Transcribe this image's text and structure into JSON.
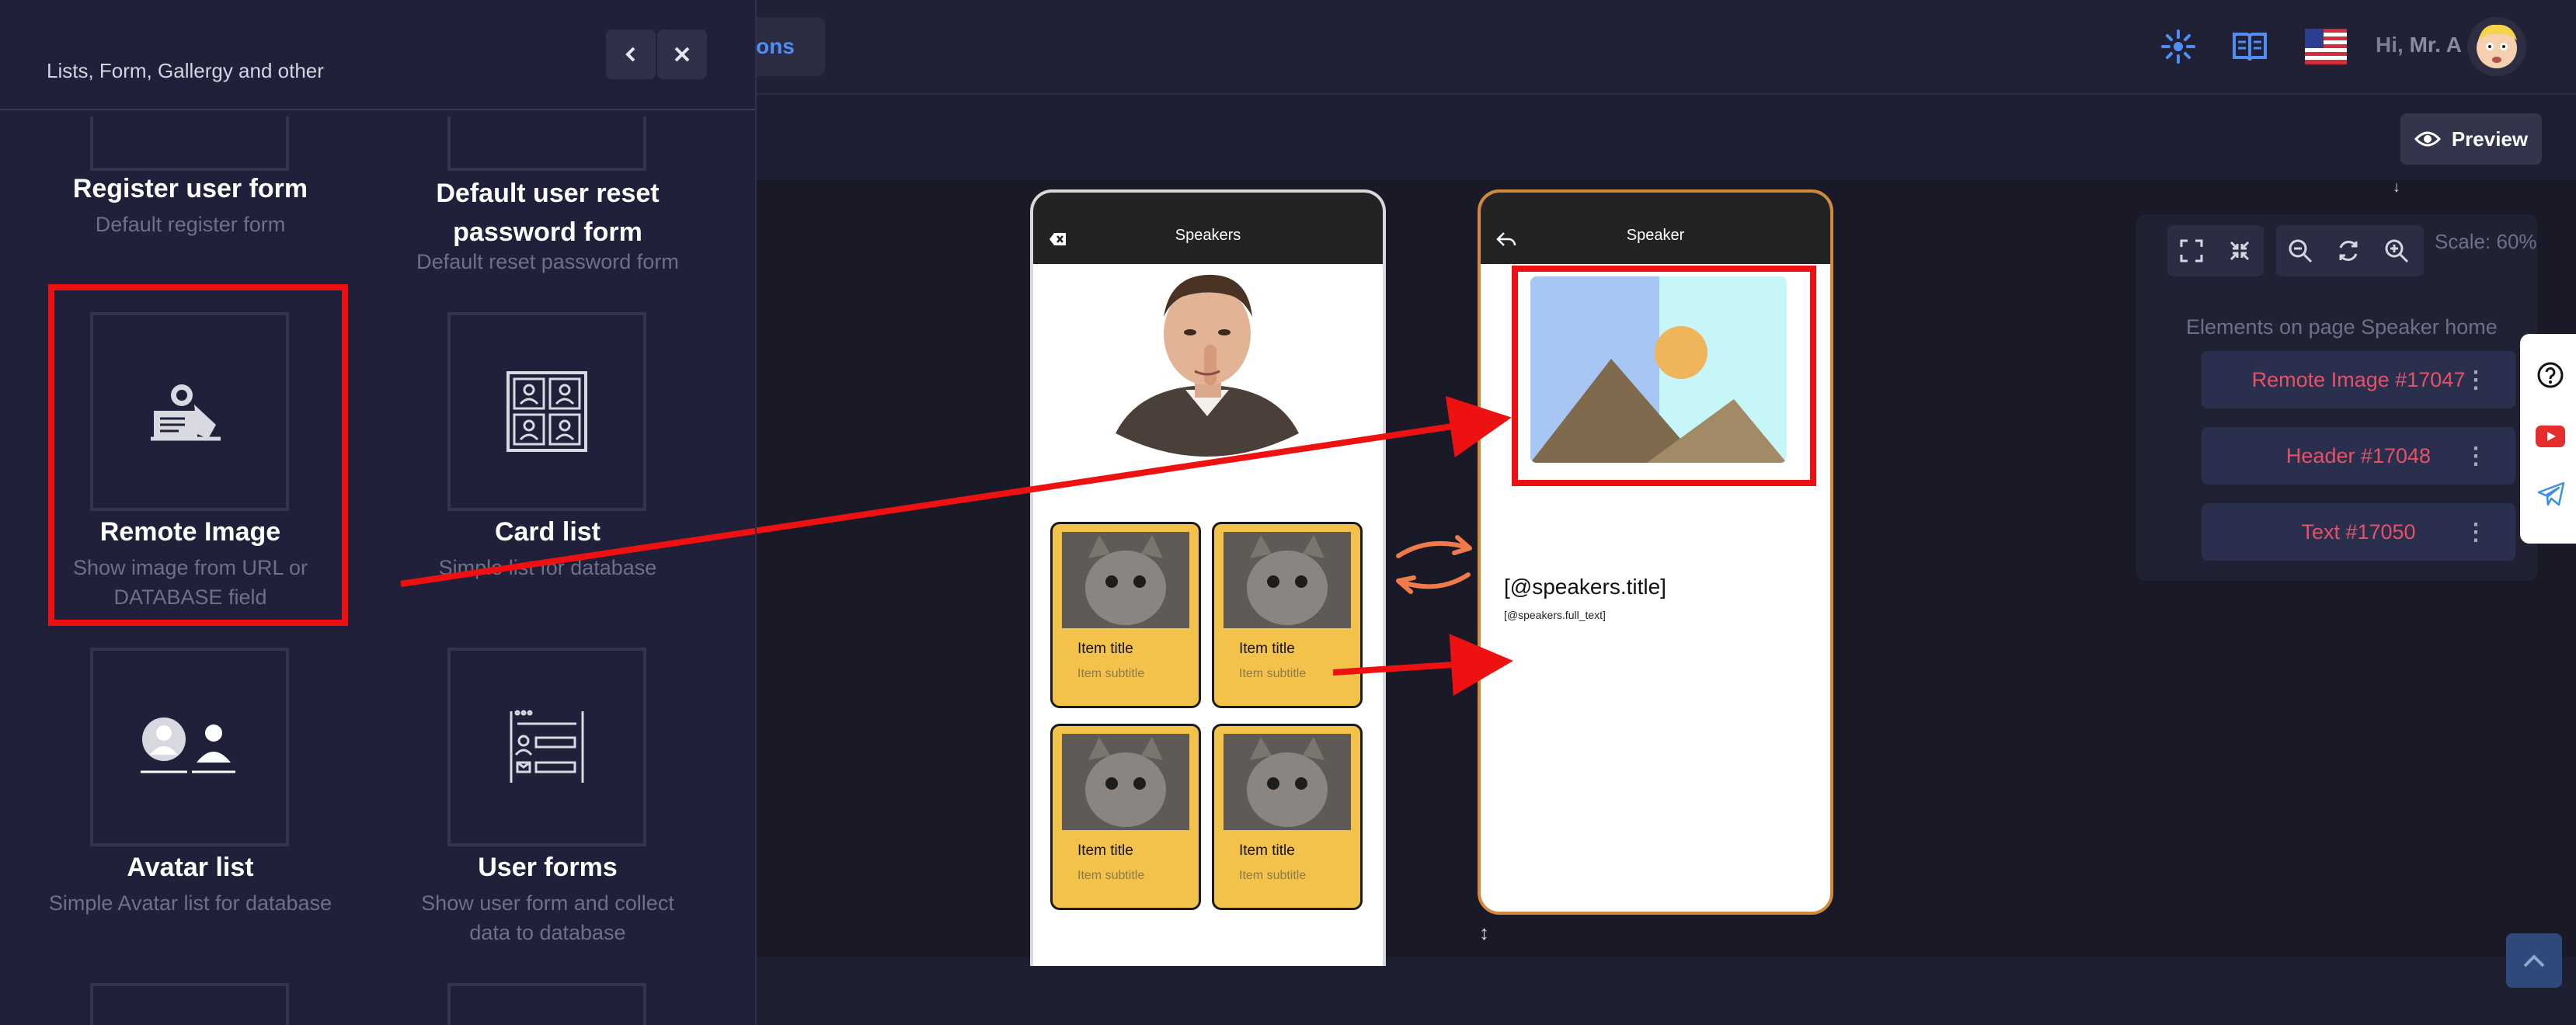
{
  "topbar": {
    "tab_label": "tions",
    "greeting_hi": "Hi,",
    "greeting_name": "Mr. A",
    "icons": [
      "spinner-icon",
      "book-icon",
      "us-flag-icon",
      "user-avatar"
    ]
  },
  "toolbar": {
    "preview_label": "Preview"
  },
  "panel": {
    "subtitle": "Lists, Form, Gallergy and other",
    "tiles": [
      {
        "title": "Register user form",
        "desc": "Default register form"
      },
      {
        "title": "Default user reset password form",
        "desc": "Default reset password form"
      },
      {
        "title": "Remote Image",
        "desc": "Show image from URL or DATABASE field"
      },
      {
        "title": "Card list",
        "desc": "Simple list for database"
      },
      {
        "title": "Avatar list",
        "desc": "Simple Avatar list for database"
      },
      {
        "title": "User forms",
        "desc": "Show user form and collect data to database"
      }
    ]
  },
  "phone_list": {
    "title": "Speakers",
    "items": [
      {
        "title": "Item title",
        "subtitle": "Item subtitle"
      },
      {
        "title": "Item title",
        "subtitle": "Item subtitle"
      },
      {
        "title": "Item title",
        "subtitle": "Item subtitle"
      },
      {
        "title": "Item title",
        "subtitle": "Item subtitle"
      }
    ]
  },
  "phone_detail": {
    "title": "Speaker",
    "bind_title": "[@speakers.title]",
    "bind_text": "[@speakers.full_text]"
  },
  "right_panel": {
    "scale": "Scale: 60%",
    "elements_label": "Elements on page Speaker home",
    "elements": [
      "Remote Image #17047",
      "Header #17048",
      "Text #17050"
    ]
  },
  "colors": {
    "accent_blue": "#4f8ef7",
    "highlight_red": "#ee1111",
    "card_yellow": "#f2c24b",
    "element_red": "#e65168",
    "phone_border_orange": "#d28a3a"
  }
}
